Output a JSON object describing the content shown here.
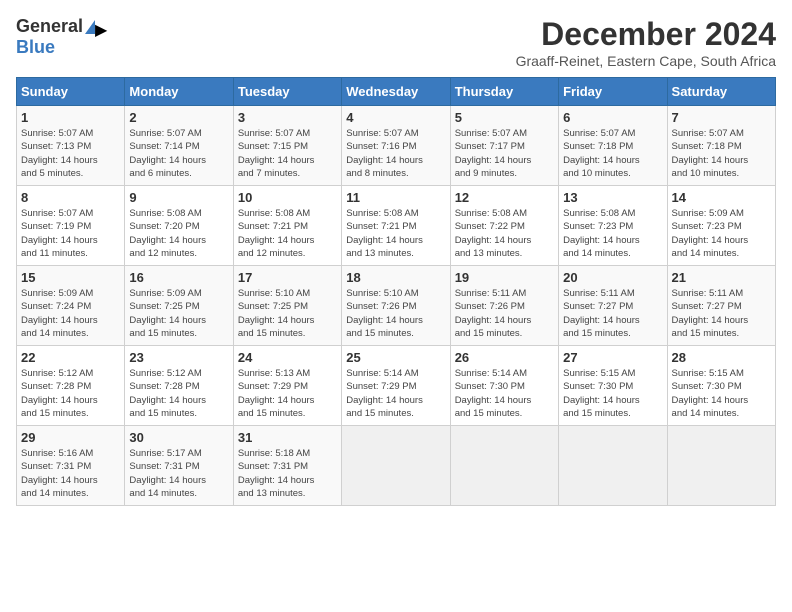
{
  "header": {
    "logo_general": "General",
    "logo_blue": "Blue",
    "month_title": "December 2024",
    "subtitle": "Graaff-Reinet, Eastern Cape, South Africa"
  },
  "weekdays": [
    "Sunday",
    "Monday",
    "Tuesday",
    "Wednesday",
    "Thursday",
    "Friday",
    "Saturday"
  ],
  "weeks": [
    [
      {
        "day": "1",
        "sunrise": "5:07 AM",
        "sunset": "7:13 PM",
        "daylight": "14 hours and 5 minutes."
      },
      {
        "day": "2",
        "sunrise": "5:07 AM",
        "sunset": "7:14 PM",
        "daylight": "14 hours and 6 minutes."
      },
      {
        "day": "3",
        "sunrise": "5:07 AM",
        "sunset": "7:15 PM",
        "daylight": "14 hours and 7 minutes."
      },
      {
        "day": "4",
        "sunrise": "5:07 AM",
        "sunset": "7:16 PM",
        "daylight": "14 hours and 8 minutes."
      },
      {
        "day": "5",
        "sunrise": "5:07 AM",
        "sunset": "7:17 PM",
        "daylight": "14 hours and 9 minutes."
      },
      {
        "day": "6",
        "sunrise": "5:07 AM",
        "sunset": "7:18 PM",
        "daylight": "14 hours and 10 minutes."
      },
      {
        "day": "7",
        "sunrise": "5:07 AM",
        "sunset": "7:18 PM",
        "daylight": "14 hours and 10 minutes."
      }
    ],
    [
      {
        "day": "8",
        "sunrise": "5:07 AM",
        "sunset": "7:19 PM",
        "daylight": "14 hours and 11 minutes."
      },
      {
        "day": "9",
        "sunrise": "5:08 AM",
        "sunset": "7:20 PM",
        "daylight": "14 hours and 12 minutes."
      },
      {
        "day": "10",
        "sunrise": "5:08 AM",
        "sunset": "7:21 PM",
        "daylight": "14 hours and 12 minutes."
      },
      {
        "day": "11",
        "sunrise": "5:08 AM",
        "sunset": "7:21 PM",
        "daylight": "14 hours and 13 minutes."
      },
      {
        "day": "12",
        "sunrise": "5:08 AM",
        "sunset": "7:22 PM",
        "daylight": "14 hours and 13 minutes."
      },
      {
        "day": "13",
        "sunrise": "5:08 AM",
        "sunset": "7:23 PM",
        "daylight": "14 hours and 14 minutes."
      },
      {
        "day": "14",
        "sunrise": "5:09 AM",
        "sunset": "7:23 PM",
        "daylight": "14 hours and 14 minutes."
      }
    ],
    [
      {
        "day": "15",
        "sunrise": "5:09 AM",
        "sunset": "7:24 PM",
        "daylight": "14 hours and 14 minutes."
      },
      {
        "day": "16",
        "sunrise": "5:09 AM",
        "sunset": "7:25 PM",
        "daylight": "14 hours and 15 minutes."
      },
      {
        "day": "17",
        "sunrise": "5:10 AM",
        "sunset": "7:25 PM",
        "daylight": "14 hours and 15 minutes."
      },
      {
        "day": "18",
        "sunrise": "5:10 AM",
        "sunset": "7:26 PM",
        "daylight": "14 hours and 15 minutes."
      },
      {
        "day": "19",
        "sunrise": "5:11 AM",
        "sunset": "7:26 PM",
        "daylight": "14 hours and 15 minutes."
      },
      {
        "day": "20",
        "sunrise": "5:11 AM",
        "sunset": "7:27 PM",
        "daylight": "14 hours and 15 minutes."
      },
      {
        "day": "21",
        "sunrise": "5:11 AM",
        "sunset": "7:27 PM",
        "daylight": "14 hours and 15 minutes."
      }
    ],
    [
      {
        "day": "22",
        "sunrise": "5:12 AM",
        "sunset": "7:28 PM",
        "daylight": "14 hours and 15 minutes."
      },
      {
        "day": "23",
        "sunrise": "5:12 AM",
        "sunset": "7:28 PM",
        "daylight": "14 hours and 15 minutes."
      },
      {
        "day": "24",
        "sunrise": "5:13 AM",
        "sunset": "7:29 PM",
        "daylight": "14 hours and 15 minutes."
      },
      {
        "day": "25",
        "sunrise": "5:14 AM",
        "sunset": "7:29 PM",
        "daylight": "14 hours and 15 minutes."
      },
      {
        "day": "26",
        "sunrise": "5:14 AM",
        "sunset": "7:30 PM",
        "daylight": "14 hours and 15 minutes."
      },
      {
        "day": "27",
        "sunrise": "5:15 AM",
        "sunset": "7:30 PM",
        "daylight": "14 hours and 15 minutes."
      },
      {
        "day": "28",
        "sunrise": "5:15 AM",
        "sunset": "7:30 PM",
        "daylight": "14 hours and 14 minutes."
      }
    ],
    [
      {
        "day": "29",
        "sunrise": "5:16 AM",
        "sunset": "7:31 PM",
        "daylight": "14 hours and 14 minutes."
      },
      {
        "day": "30",
        "sunrise": "5:17 AM",
        "sunset": "7:31 PM",
        "daylight": "14 hours and 14 minutes."
      },
      {
        "day": "31",
        "sunrise": "5:18 AM",
        "sunset": "7:31 PM",
        "daylight": "14 hours and 13 minutes."
      },
      null,
      null,
      null,
      null
    ]
  ],
  "labels": {
    "sunrise_prefix": "Sunrise: ",
    "sunset_prefix": "Sunset: ",
    "daylight_prefix": "Daylight: "
  }
}
